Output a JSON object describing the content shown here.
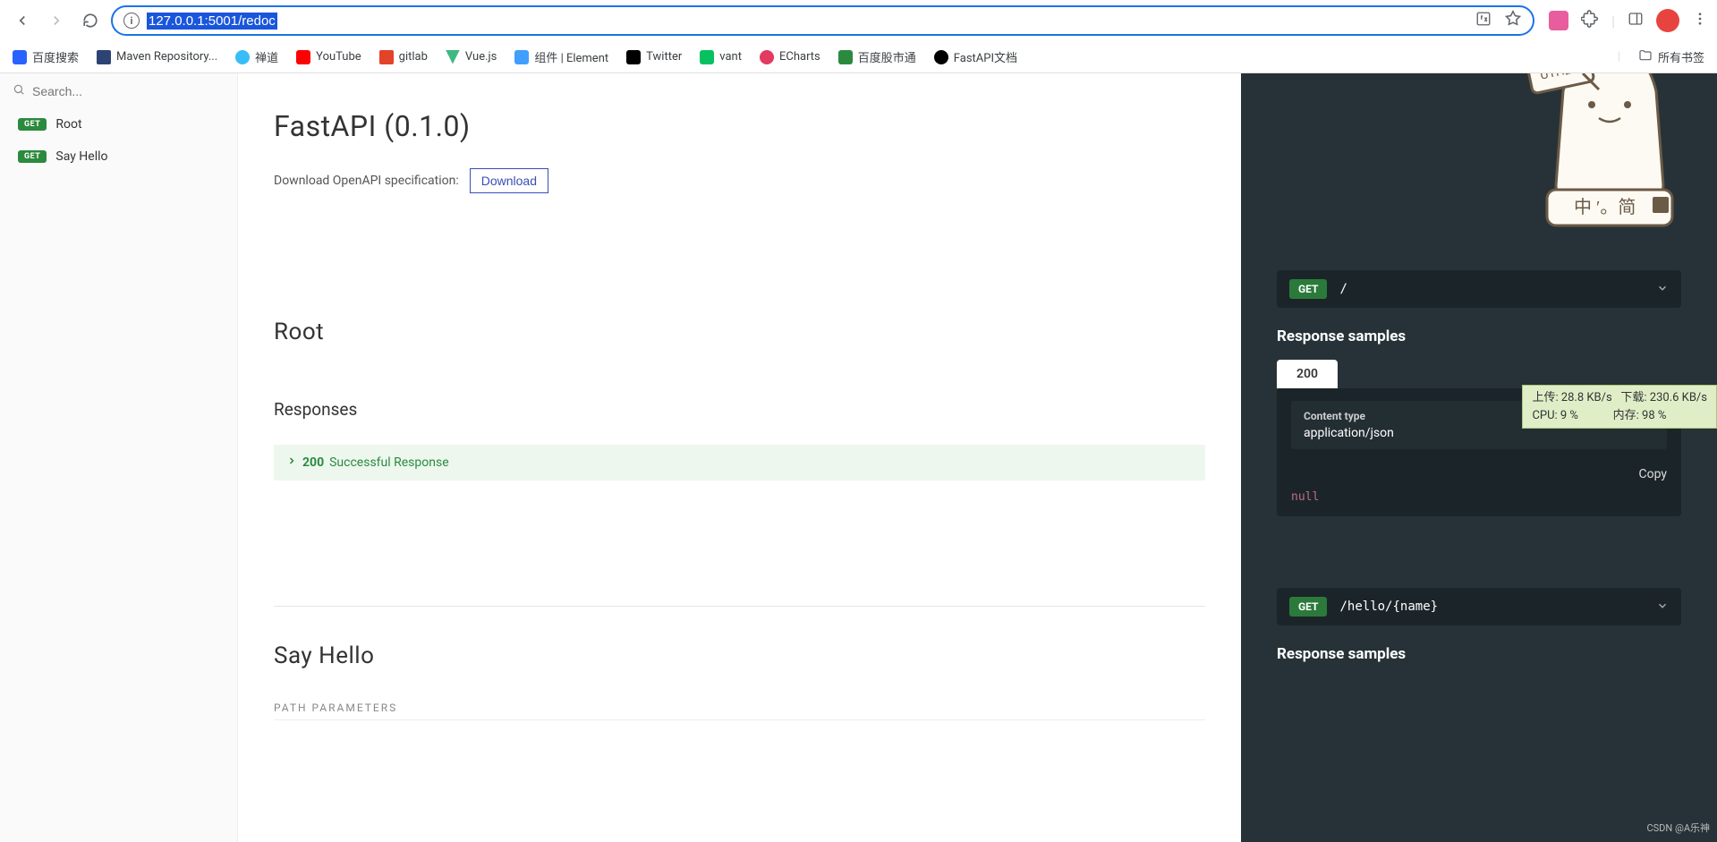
{
  "browser": {
    "url": "127.0.0.1:5001/redoc",
    "bookmarks": [
      {
        "label": "百度搜索",
        "color": "#2962ff"
      },
      {
        "label": "Maven Repository...",
        "color": "#2d4373"
      },
      {
        "label": "禅道",
        "color": "#38bdf8"
      },
      {
        "label": "YouTube",
        "color": "#ff0000"
      },
      {
        "label": "gitlab",
        "color": "#e24329"
      },
      {
        "label": "Vue.js",
        "color": "#41b883"
      },
      {
        "label": "组件 | Element",
        "color": "#409eff"
      },
      {
        "label": "Twitter",
        "color": "#000000"
      },
      {
        "label": "vant",
        "color": "#07c160"
      },
      {
        "label": "ECharts",
        "color": "#e43961"
      },
      {
        "label": "百度股市通",
        "color": "#2b8a3e"
      },
      {
        "label": "FastAPI文档",
        "color": "#000000"
      }
    ],
    "all_bookmarks": "所有书签"
  },
  "sidebar": {
    "search_placeholder": "Search...",
    "items": [
      {
        "method": "GET",
        "label": "Root"
      },
      {
        "method": "GET",
        "label": "Say Hello"
      }
    ]
  },
  "header": {
    "title": "FastAPI (0.1.0)",
    "download_label": "Download OpenAPI specification:",
    "download_btn": "Download"
  },
  "sections": [
    {
      "title": "Root",
      "responses_label": "Responses",
      "responses": [
        {
          "code": "200",
          "desc": "Successful Response"
        }
      ]
    },
    {
      "title": "Say Hello",
      "path_params_label": "PATH PARAMETERS"
    }
  ],
  "right": {
    "endpoints": [
      {
        "method": "GET",
        "path": "/"
      },
      {
        "method": "GET",
        "path": "/hello/{name}"
      }
    ],
    "response_samples_label": "Response samples",
    "tab": "200",
    "content_type_label": "Content type",
    "content_type_value": "application/json",
    "copy_label": "Copy",
    "sample_body": "null"
  },
  "monitor": {
    "line1a": "上传: 28.8 KB/s",
    "line1b": "下载: 230.6 KB/s",
    "line2a": "CPU: 9 %",
    "line2b": "内存: 98 %"
  },
  "watermark": "CSDN @A乐神"
}
